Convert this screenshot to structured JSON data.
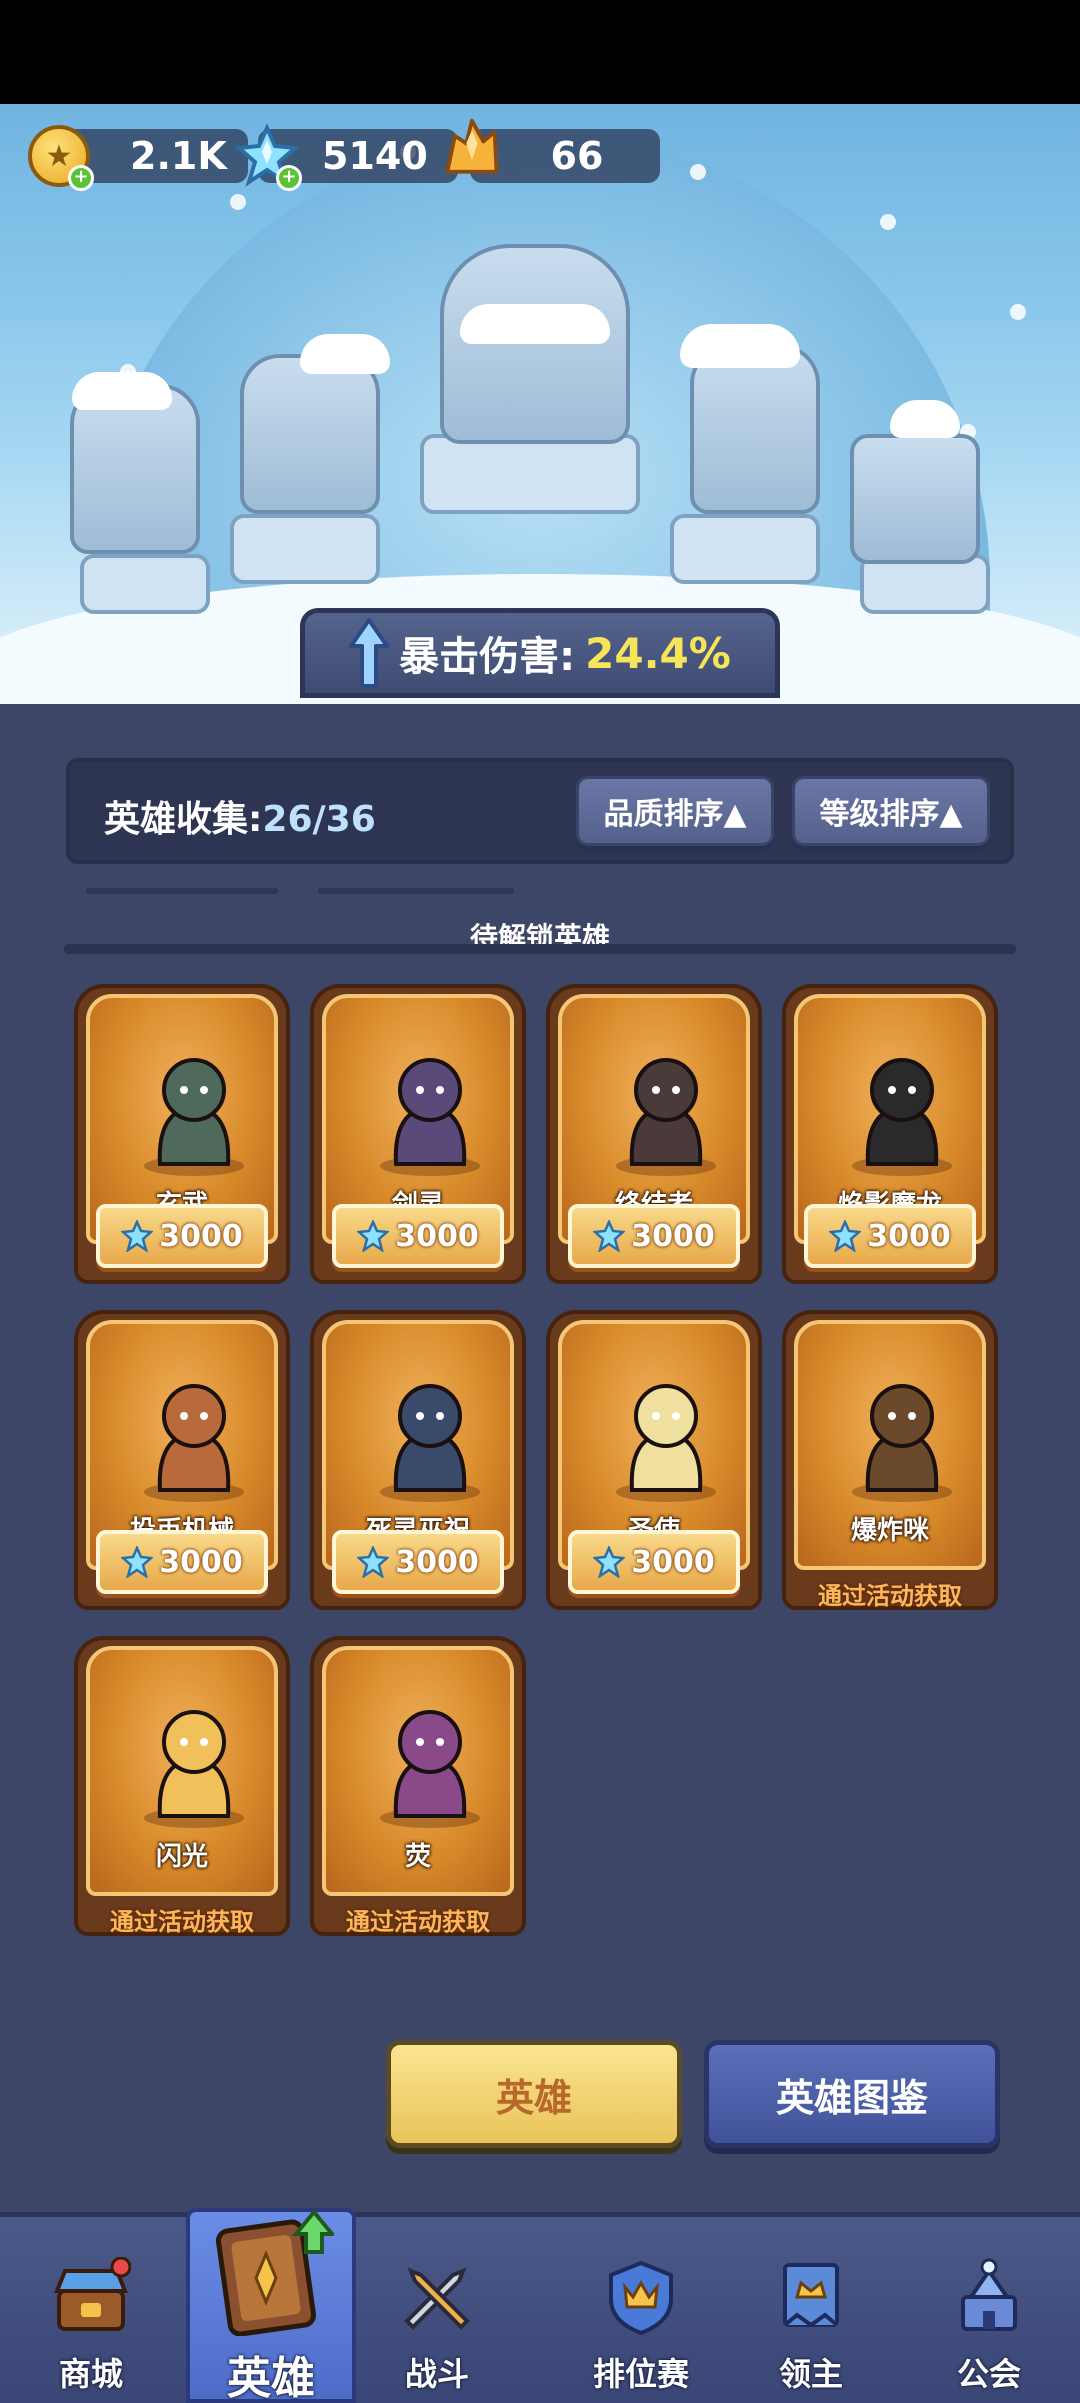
{
  "currencies": {
    "gold": "2.1K",
    "crystal": "5140",
    "amber": "66"
  },
  "crit": {
    "label": "暴击伤害:",
    "value": "24.4%"
  },
  "collection": {
    "label": "英雄收集:",
    "count": "26/36",
    "sort_quality": "品质排序▲",
    "sort_level": "等级排序▲"
  },
  "locked_section_title": "待解锁英雄",
  "heroes": [
    {
      "name": "玄武",
      "price": "3000"
    },
    {
      "name": "剑灵",
      "price": "3000"
    },
    {
      "name": "终结者",
      "price": "3000"
    },
    {
      "name": "焰影魔龙",
      "price": "3000"
    },
    {
      "name": "投币机械",
      "price": "3000"
    },
    {
      "name": "死灵巫祝",
      "price": "3000"
    },
    {
      "name": "圣使",
      "price": "3000"
    },
    {
      "name": "爆炸咪",
      "event": "通过活动获取"
    },
    {
      "name": "闪光",
      "event": "通过活动获取"
    },
    {
      "name": "荧",
      "event": "通过活动获取"
    }
  ],
  "buttons": {
    "hero": "英雄",
    "codex": "英雄图鉴"
  },
  "nav": {
    "shop": "商城",
    "hero": "英雄",
    "battle": "战斗",
    "ranked": "排位赛",
    "lord": "领主",
    "guild": "公会"
  },
  "colors": {
    "background": "#3d4666",
    "crit_value": "#f6e55a",
    "card_bg": "#d88a2a",
    "event_text": "#ffb65a"
  }
}
